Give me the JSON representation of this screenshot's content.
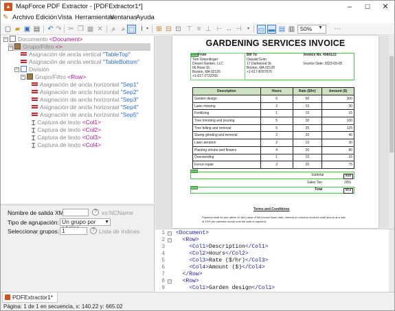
{
  "window": {
    "title": "MapForce PDF Extractor - [PDFExtractor1*]",
    "minimize": "–",
    "maximize": "☐",
    "close": "✕"
  },
  "menu": [
    "Archivo",
    "Edición",
    "Vista",
    "Herramientas",
    "Ventanas",
    "Ayuda"
  ],
  "toolbar": {
    "zoom": "50%"
  },
  "tree": {
    "root": {
      "label": "Documento",
      "element": "<Document>"
    },
    "group": {
      "label": "Grupo/Filtro",
      "element": "<>"
    },
    "anchor_top": {
      "label": "Asignación de ancla vertical",
      "value": "\"TableTop\""
    },
    "anchor_bottom": {
      "label": "Asignación de ancla vertical",
      "value": "\"TableBottom\""
    },
    "division": {
      "label": "División"
    },
    "row_group": {
      "label": "Grupo/Filtro",
      "element": "<Row>"
    },
    "seps": [
      {
        "label": "Asignación de ancla horizontal",
        "value": "\"Sep1\""
      },
      {
        "label": "Asignación de ancla horizontal",
        "value": "\"Sep2\""
      },
      {
        "label": "Asignación de ancla horizontal",
        "value": "\"Sep3\""
      },
      {
        "label": "Asignación de ancla horizontal",
        "value": "\"Sep4\""
      },
      {
        "label": "Asignación de ancla horizontal",
        "value": "\"Sep5\""
      }
    ],
    "captures": [
      {
        "label": "Captura de texto",
        "element": "<Col1>"
      },
      {
        "label": "Captura de texto",
        "element": "<Col2>"
      },
      {
        "label": "Captura de texto",
        "element": "<Col3>"
      },
      {
        "label": "Captura de texto",
        "element": "<Col4>"
      }
    ]
  },
  "props": {
    "xml_name_label": "Nombre de salida XML:",
    "xml_name_placeholder": "xs:NCName",
    "grouping_label": "Tipo de agrupación:",
    "grouping_value": "Un grupo por página",
    "select_groups_label": "Seleccionar grupos:",
    "select_groups_value": "1",
    "select_groups_hint": "Lista de índices",
    "help": "?"
  },
  "invoice": {
    "title": "GARDENING SERVICES INVOICE",
    "from_head": "From",
    "from_lines": [
      "Tom Greenfinger",
      "Dream Garden, LLC",
      "66 Rose St.",
      "Boston, MA 02126",
      "+1-617-2732765"
    ],
    "bill_head": "Bill To",
    "bill_lines": [
      "Oswald Grim",
      "17 Darkwood St.",
      "Boston, MA 02128",
      "+1-617-8767675"
    ],
    "invoice_no": "Invoice No. 4560123",
    "invoice_date": "Invoice Date: 2023-09-05",
    "headers": [
      "Description",
      "Hours",
      "Rate ($/hr)",
      "Amount ($)"
    ],
    "rows": [
      [
        "Garden design",
        "6",
        "50",
        "300"
      ],
      [
        "Lawn mowing",
        "2",
        "15",
        "30"
      ],
      [
        "Fertilizing",
        "1",
        "15",
        "15"
      ],
      [
        "Tree trimming and pruning",
        "5",
        "20",
        "100"
      ],
      [
        "Tree felling and removal",
        "5",
        "25",
        "125"
      ],
      [
        "Stump grinding and removal",
        "2",
        "20",
        "40"
      ],
      [
        "Lawn aeration",
        "2",
        "15",
        "30"
      ],
      [
        "Planting shrubs and flowers",
        "4",
        "20",
        "80"
      ],
      [
        "Overseeding",
        "1",
        "15",
        "15"
      ],
      [
        "Fence repair",
        "3",
        "25",
        "75"
      ]
    ],
    "subtotal_label": "Subtotal",
    "subtotal": "810",
    "tax_label": "Sales Tax",
    "tax": "20%",
    "total_label": "Total",
    "total": "972",
    "tag": "New",
    "terms_title": "Terms and Conditions",
    "terms_text1": "Payment shall be due within 10 (ten) days of the invoice issue date. Interest on overdue invoices shall accrue at a rate",
    "terms_text2": "of 10% per calendar month until the date of payment."
  },
  "xml": [
    {
      "n": "1",
      "code": "<Document>",
      "fold": "−"
    },
    {
      "n": "2",
      "code": "  <Row>",
      "fold": "−"
    },
    {
      "n": "3",
      "code": "    <Col1>Description</Col1>",
      "fold": ""
    },
    {
      "n": "4",
      "code": "    <Col2>Hours</Col2>",
      "fold": ""
    },
    {
      "n": "5",
      "code": "    <Col3>Rate ($/hr)</Col3>",
      "fold": ""
    },
    {
      "n": "6",
      "code": "    <Col4>Amount ($)</Col4>",
      "fold": ""
    },
    {
      "n": "7",
      "code": "  </Row>",
      "fold": ""
    },
    {
      "n": "8",
      "code": "  <Row>",
      "fold": "−"
    },
    {
      "n": "9",
      "code": "    <Col1>Garden design</Col1>",
      "fold": ""
    }
  ],
  "tab": "PDFExtractor1*",
  "status": "Página: 1 de 1 en secuencia, x: 140.22  y: 665.02"
}
